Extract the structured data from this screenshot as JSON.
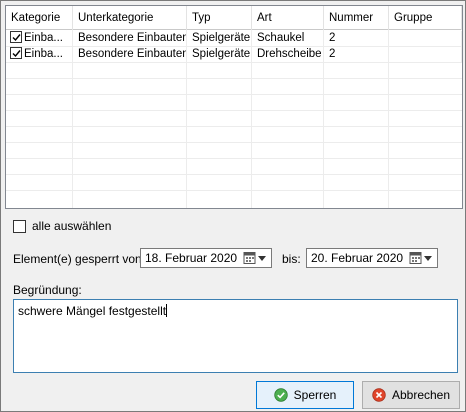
{
  "grid": {
    "columns": [
      "Kategorie",
      "Unterkategorie",
      "Typ",
      "Art",
      "Nummer",
      "Gruppe"
    ],
    "rows": [
      {
        "checked": true,
        "kategorie": "Einba...",
        "unterkategorie": "Besondere Einbauten",
        "typ": "Spielgeräte",
        "art": "Schaukel",
        "nummer": "2",
        "gruppe": ""
      },
      {
        "checked": true,
        "kategorie": "Einba...",
        "unterkategorie": "Besondere Einbauten",
        "typ": "Spielgeräte",
        "art": "Drehscheibe",
        "nummer": "2",
        "gruppe": ""
      }
    ]
  },
  "select_all": {
    "label": "alle auswählen",
    "checked": false
  },
  "dates": {
    "from_label": "Element(e) gesperrt von:",
    "from_value": "18.  Februar   2020",
    "to_label": "bis:",
    "to_value": "20.  Februar   2020"
  },
  "reason": {
    "label": "Begründung:",
    "value": "schwere Mängel festgestellt"
  },
  "buttons": {
    "lock_label": "Sperren",
    "cancel_label": "Abbrechen"
  },
  "icons": {
    "checkbox": "check-mark",
    "calendar": "calendar-icon",
    "lock_button_icon": "green-check-circle-icon",
    "cancel_button_icon": "red-x-circle-icon"
  },
  "colors": {
    "focus_border": "#3c7fb1",
    "primary_border": "#0078d7",
    "ok_icon": "#4caf50",
    "cancel_icon": "#e0452b"
  }
}
